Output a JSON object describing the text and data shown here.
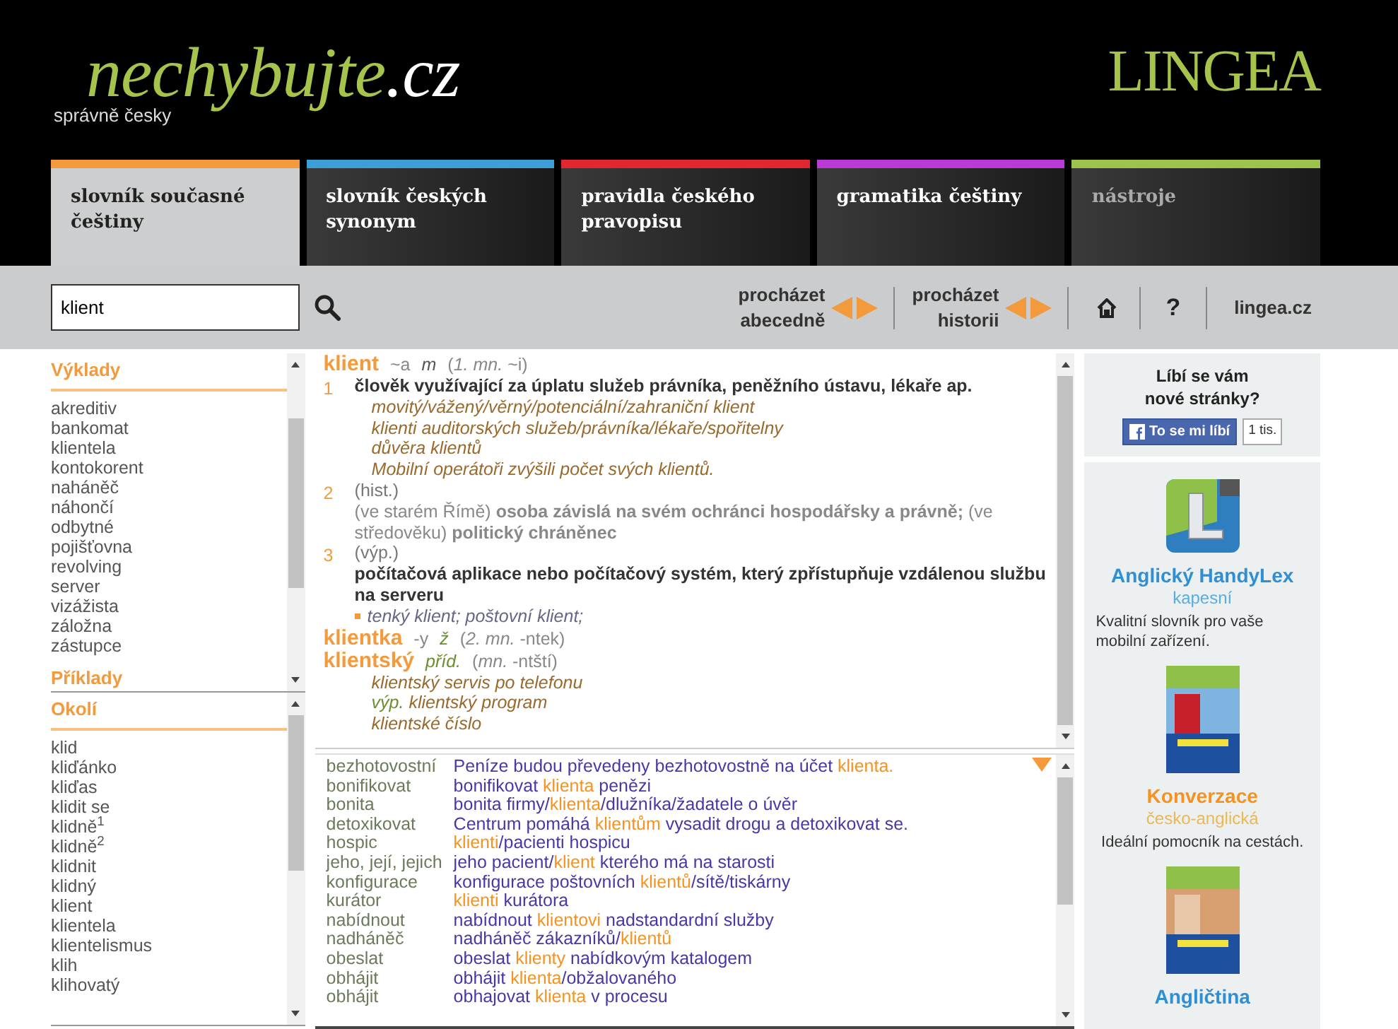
{
  "header": {
    "logo": {
      "name": "nechybujte",
      "suffix": ".cz"
    },
    "tagline": "správně česky",
    "brand": "LINGEA"
  },
  "tabs": [
    {
      "label": "slovník současné češtiny",
      "color": "#f39a3c",
      "selected": true,
      "disabled": false
    },
    {
      "label": "slovník českých synonym",
      "color": "#3d9fd8",
      "selected": false,
      "disabled": false
    },
    {
      "label": "pravidla českého pravopisu",
      "color": "#e3262f",
      "selected": false,
      "disabled": false
    },
    {
      "label": "gramatika češtiny",
      "color": "#b93ad6",
      "selected": false,
      "disabled": false
    },
    {
      "label": "nástroje",
      "color": "#9cc44c",
      "selected": false,
      "disabled": true
    }
  ],
  "search": {
    "value": "klient",
    "browse_alphabet": "procházet abecedně",
    "browse_history": "procházet historii",
    "help": "?",
    "site_link": "lingea.cz"
  },
  "sidebar": {
    "panels": [
      {
        "sections": [
          {
            "title": "Výklady",
            "items": [
              "akreditiv",
              "bankomat",
              "klientela",
              "kontokorent",
              "naháněč",
              "náhončí",
              "odbytné",
              "pojišťovna",
              "revolving",
              "server",
              "vizážista",
              "záložna",
              "zástupce"
            ]
          },
          {
            "title": "Příklady"
          }
        ]
      },
      {
        "sections": [
          {
            "title": "Okolí",
            "items": [
              "klid",
              "kliďánko",
              "kliďas",
              "klidit se",
              "klidně$^{1}$",
              "klidně$^{2}$",
              "klidnit",
              "klidný",
              "klient",
              "klientela",
              "klientelismus",
              "klih",
              "klihovatý"
            ]
          }
        ]
      }
    ]
  },
  "definition": {
    "entries": [
      {
        "headword": "klient",
        "grammar": [
          {
            "text": "~a",
            "kind": "form"
          },
          {
            "text": "m",
            "kind": "gender"
          },
          {
            "text": "(*1. mn.* ~i)",
            "kind": "form"
          }
        ],
        "senses": [
          {
            "number": "1",
            "lines": [
              {
                "kind": "definition",
                "text": "člověk využívající za úplatu služeb právníka, peněžního ústavu, lékaře ap."
              },
              {
                "kind": "example",
                "text": "movitý/vážený/věrný/potenciální/zahraniční klient"
              },
              {
                "kind": "example",
                "text": "klienti auditorských služeb/právníka/lékaře/spořitelny"
              },
              {
                "kind": "example",
                "text": "důvěra klientů"
              },
              {
                "kind": "example",
                "text": "Mobilní operátoři zvýšili počet svých klientů."
              }
            ]
          },
          {
            "number": "2",
            "lines": [
              {
                "kind": "note",
                "text": "(hist.)"
              },
              {
                "kind": "mixed",
                "text": "(ve starém Římě) **osoba závislá na svém ochránci hospodářsky a právně;** (ve středověku) **politický chráněnec**"
              }
            ]
          },
          {
            "number": "3",
            "lines": [
              {
                "kind": "note",
                "text": "(výp.)"
              },
              {
                "kind": "definition",
                "text": "počítačová aplikace nebo počítačový systém, který zpřístupňuje vzdálenou službu na serveru"
              },
              {
                "kind": "phrase",
                "text": "tenký klient; poštovní klient;"
              }
            ]
          }
        ]
      },
      {
        "headword": "klientka",
        "grammar": [
          {
            "text": "-y",
            "kind": "form"
          },
          {
            "text": "ž",
            "kind": "pos"
          },
          {
            "text": "(*2. mn.* -ntek)",
            "kind": "form"
          }
        ]
      },
      {
        "headword": "klientský",
        "grammar": [
          {
            "text": "příd.",
            "kind": "pos"
          },
          {
            "text": "(*mn.* -ntští)",
            "kind": "form"
          }
        ],
        "lines": [
          {
            "kind": "example",
            "text": "klientský servis po telefonu"
          },
          {
            "kind": "example",
            "label": "výp.",
            "text": "klientský program"
          },
          {
            "kind": "example",
            "text": "klientské číslo"
          }
        ]
      }
    ]
  },
  "examples": {
    "rows": [
      {
        "word": "bezhotovostní",
        "parts": [
          {
            "text": "Peníze budou převedeny bezhotovostně na účet ",
            "highlight": false
          },
          {
            "text": "klienta.",
            "highlight": true
          }
        ]
      },
      {
        "word": "bonifikovat",
        "parts": [
          {
            "text": "bonifikovat ",
            "highlight": false
          },
          {
            "text": "klienta",
            "highlight": true
          },
          {
            "text": " penězi",
            "highlight": false
          }
        ]
      },
      {
        "word": "bonita",
        "parts": [
          {
            "text": "bonita firmy/",
            "highlight": false
          },
          {
            "text": "klienta",
            "highlight": true
          },
          {
            "text": "/dlužníka/žadatele o úvěr",
            "highlight": false
          }
        ]
      },
      {
        "word": "detoxikovat",
        "parts": [
          {
            "text": "Centrum pomáhá ",
            "highlight": false
          },
          {
            "text": "klientům",
            "highlight": true
          },
          {
            "text": " vysadit drogu a detoxikovat se.",
            "highlight": false
          }
        ]
      },
      {
        "word": "hospic",
        "parts": [
          {
            "text": "klienti",
            "highlight": true
          },
          {
            "text": "/pacienti hospicu",
            "highlight": false
          }
        ]
      },
      {
        "word": "jeho, její, jejich",
        "parts": [
          {
            "text": "jeho pacient/",
            "highlight": false
          },
          {
            "text": "klient",
            "highlight": true
          },
          {
            "text": " kterého má na starosti",
            "highlight": false
          }
        ]
      },
      {
        "word": "konfigurace",
        "parts": [
          {
            "text": "konfigurace poštovních ",
            "highlight": false
          },
          {
            "text": "klientů",
            "highlight": true
          },
          {
            "text": "/sítě/tiskárny",
            "highlight": false
          }
        ]
      },
      {
        "word": "kurátor",
        "parts": [
          {
            "text": "klienti",
            "highlight": true
          },
          {
            "text": " kurátora",
            "highlight": false
          }
        ]
      },
      {
        "word": "nabídnout",
        "parts": [
          {
            "text": "nabídnout ",
            "highlight": false
          },
          {
            "text": "klientovi",
            "highlight": true
          },
          {
            "text": " nadstandardní služby",
            "highlight": false
          }
        ]
      },
      {
        "word": "nadháněč",
        "parts": [
          {
            "text": "nadháněč zákazníků/",
            "highlight": false
          },
          {
            "text": "klientů",
            "highlight": true
          }
        ]
      },
      {
        "word": "obeslat",
        "parts": [
          {
            "text": "obeslat ",
            "highlight": false
          },
          {
            "text": "klienty",
            "highlight": true
          },
          {
            "text": " nabídkovým katalogem",
            "highlight": false
          }
        ]
      },
      {
        "word": "obhájit",
        "parts": [
          {
            "text": "obhájit ",
            "highlight": false
          },
          {
            "text": "klienta",
            "highlight": true
          },
          {
            "text": "/obžalovaného",
            "highlight": false
          }
        ]
      },
      {
        "word": "obhájit",
        "parts": [
          {
            "text": "obhajovat ",
            "highlight": false
          },
          {
            "text": "klienta",
            "highlight": true
          },
          {
            "text": " v procesu",
            "highlight": false
          }
        ]
      }
    ]
  },
  "promo": {
    "like_box": {
      "question": "Líbí se vám nové stránky?",
      "button": "To se mi líbí",
      "count": "1 tis."
    },
    "products": [
      {
        "kind": "app",
        "title": "Anglický HandyLex",
        "subtitle": "kapesní",
        "description": "Kvalitní slovník pro vaše mobilní zařízení.",
        "color": "#2e8fd4"
      },
      {
        "kind": "book",
        "title": "Konverzace",
        "subtitle": "česko-anglická",
        "description": "Ideální pomocník na cestách.",
        "color": "#f7921e"
      },
      {
        "kind": "book",
        "title": "Angličtina",
        "color": "#2e8fd4"
      }
    ]
  }
}
